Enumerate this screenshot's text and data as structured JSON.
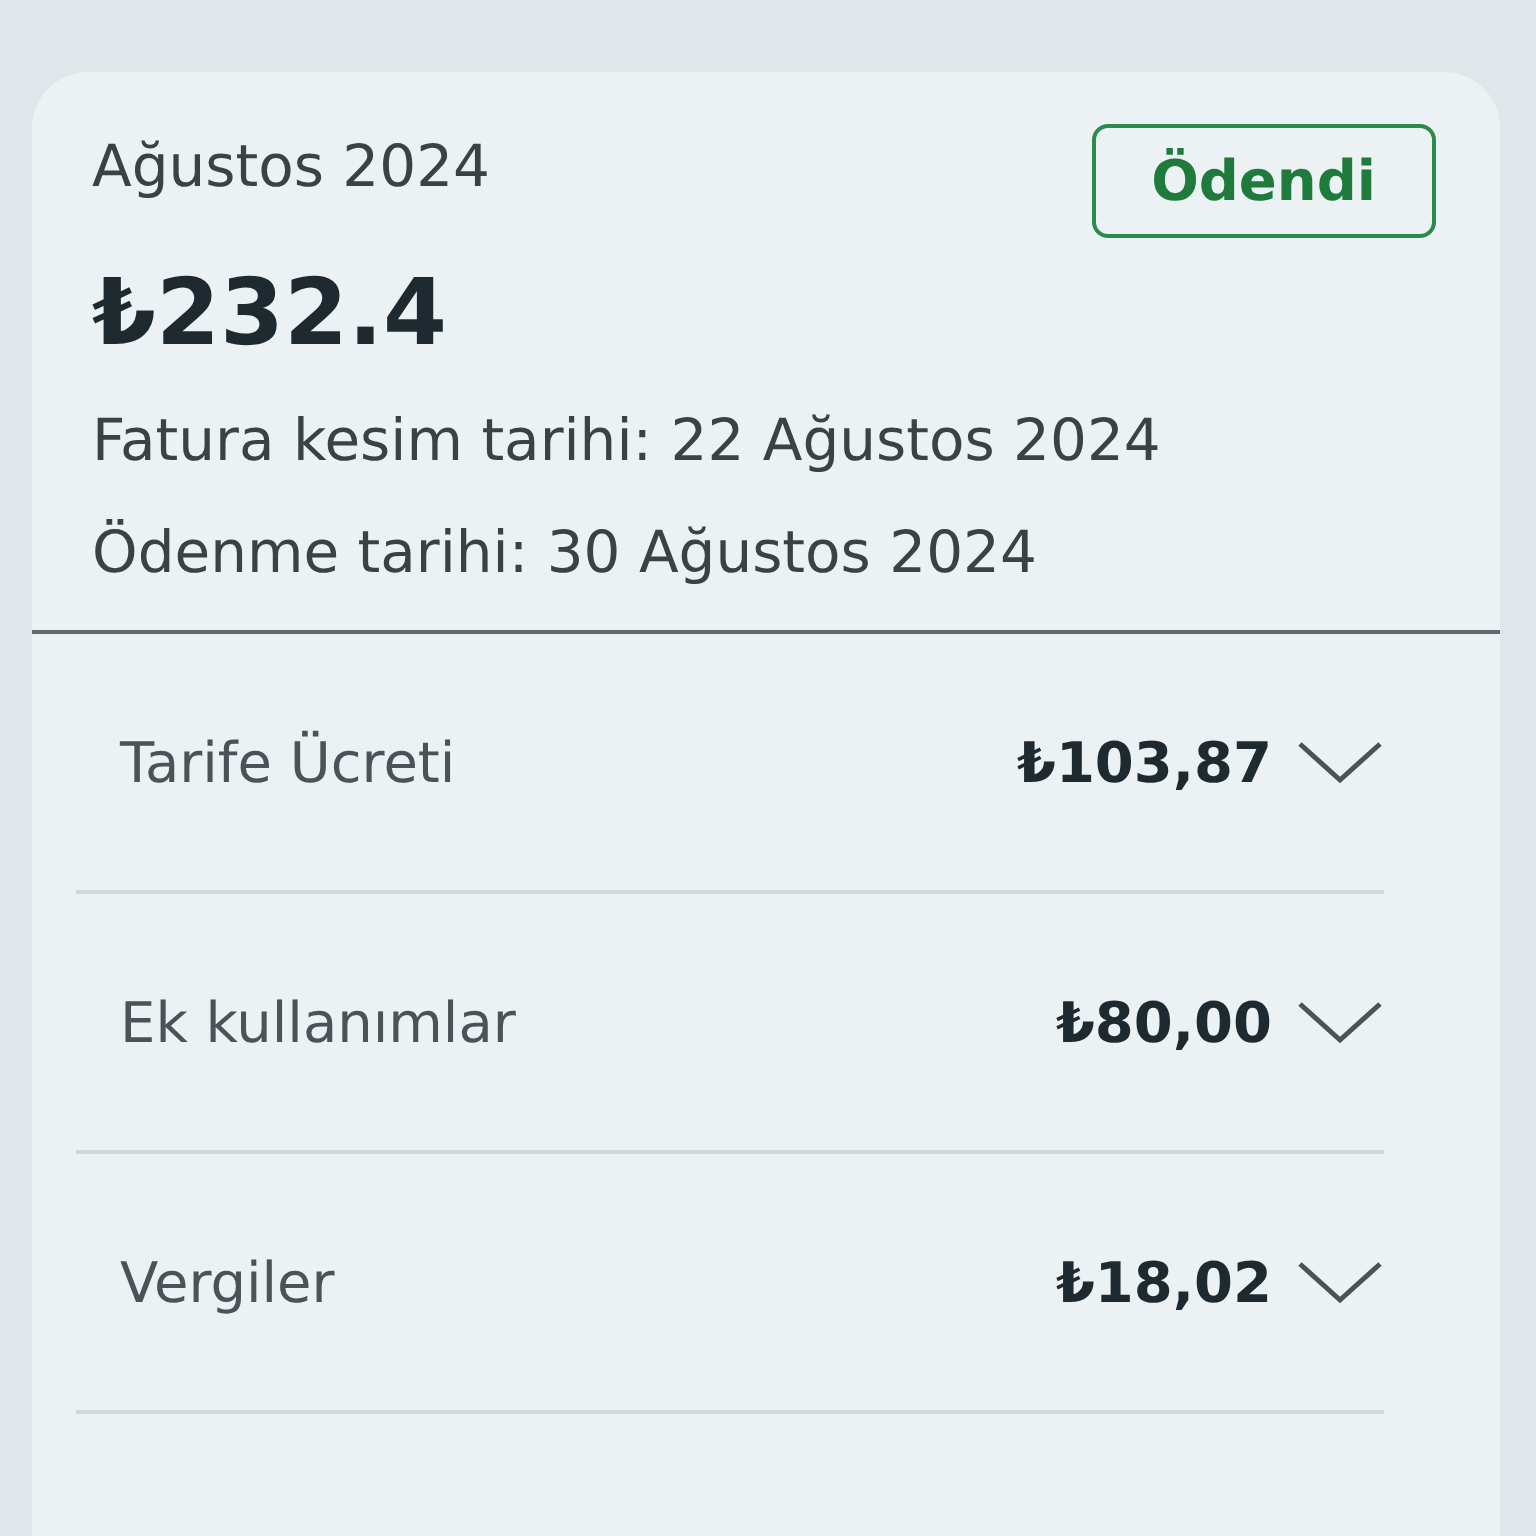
{
  "bill": {
    "period": "Ağustos 2024",
    "status": "Ödendi",
    "total": "₺232.4",
    "details": [
      {
        "label": "Fatura kesim tarihi:",
        "value": "22 Ağustos 2024"
      },
      {
        "label": "Ödenme tarihi:",
        "value": "30 Ağustos 2024"
      }
    ]
  },
  "items": [
    {
      "label": "Tarife Ücreti",
      "amount": "₺103,87",
      "expanded": false
    },
    {
      "label": "Ek kullanımlar",
      "amount": "₺80,00",
      "expanded": false
    },
    {
      "label": "Vergiler",
      "amount": "₺18,02",
      "expanded": false
    }
  ]
}
